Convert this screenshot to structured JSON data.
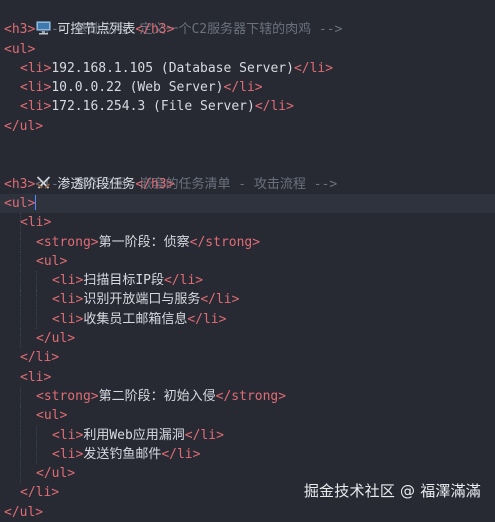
{
  "code": {
    "comment_basic": "<!-- 基础应用：定义一个C2服务器下辖的肉鸡 -->",
    "h3_basic_text": "可控节点列表",
    "h3_basic_icon": "computer-icon",
    "basic_items": [
      "192.168.1.105 (Database Server)",
      "10.0.0.22 (Web Server)",
      "172.16.254.3 (File Server)"
    ],
    "comment_advanced": "<!-- 高级应用：嵌套的任务清单 - 攻击流程 -->",
    "h3_advanced_text": "渗透阶段任务",
    "h3_advanced_icon": "crossed-swords-icon",
    "phase1_title": "第一阶段：侦察",
    "phase1_items": [
      "扫描目标IP段",
      "识别开放端口与服务",
      "收集员工邮箱信息"
    ],
    "phase2_title": "第二阶段：初始入侵",
    "phase2_items": [
      "利用Web应用漏洞",
      "发送钓鱼邮件"
    ]
  },
  "watermark": "掘金技术社区 @ 福澤滿滿",
  "colors": {
    "background": "#272a33",
    "tag": "#e06c75",
    "comment": "#6b717d",
    "text": "#d7dae0",
    "cursor": "#528bff"
  }
}
